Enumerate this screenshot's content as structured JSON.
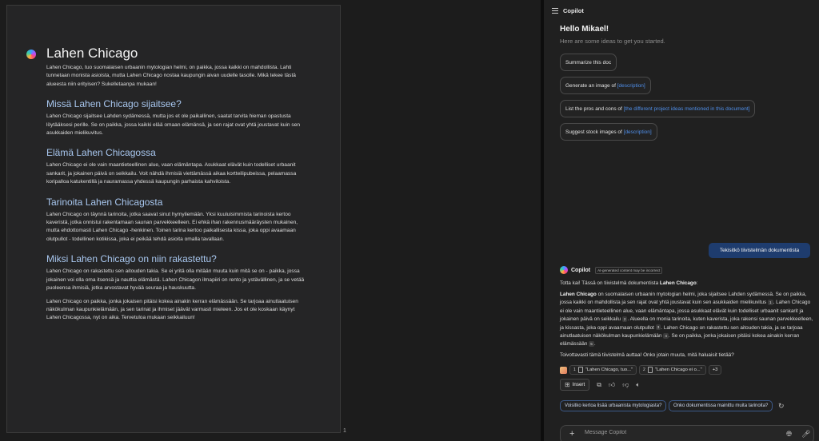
{
  "document": {
    "title": "Lahen Chicago",
    "intro": "Lahen Chicago, tuo suomalaisen urbaanin mytologian helmi, on paikka, jossa kaikki on mahdollista. Lahti tunnetaan monista asioista, mutta Lahen Chicago nostaa kaupungin aivan uudelle tasolle. Mikä tekee tästä alueesta niin erityisen? Sukelletaanpa mukaan!",
    "sections": [
      {
        "heading": "Missä Lahen Chicago sijaitsee?",
        "paragraphs": [
          "Lahen Chicago sijaitsee Lahden sydämessä, mutta jos et ole paikallinen, saatat tarvita hieman opastusta löytääksesi perille. Se on paikka, jossa kaikki elää omaan elämänsä, ja sen rajat ovat yhtä joustavat kuin sen asukkaiden mielikuvitus."
        ]
      },
      {
        "heading": "Elämä Lahen Chicagossa",
        "paragraphs": [
          "Lahen Chicago ei ole vain maantieteellinen alue, vaan elämäntapa. Asukkaat elävät kuin todelliset urbaanit sankarit, ja jokainen päivä on seikkailu. Voit nähdä ihmisiä viettämässä aikaa kortteilipubeissa, pelaamassa koripalloa katukentillä ja nauramassa yhdessä kaupungin parhaista kahviloista."
        ]
      },
      {
        "heading": "Tarinoita Lahen Chicagosta",
        "paragraphs": [
          "Lahen Chicago on täynnä tarinoita, jotka saavat sinut hymyilemään. Yksi kuuluisimmista tarinoista kertoo kaveristä, jotka onnistui rakentamaan saunan parvekkeelleen. Ei ehkä ihan rakennusmääräysten mukainen, mutta ehdottomasti Lahen Chicago -henkinen. Toinen tarina kertoo paikallisesta kissa, joka oppi avaamaan olutpullot - todellinen kotikissa, joka ei peikää tehdä asioita omalla tavallaan."
        ]
      },
      {
        "heading": "Miksi Lahen Chicago on niin rakastettu?",
        "paragraphs": [
          "Lahen Chicago on rakastettu sen aitouden takia. Se ei yritä olla mitään muuta kuin mitä se on - paikka, jossa jokainen voi olla oma itsensä ja nauttia elämästä. Lahen Chicagon ilmapiiri on rento ja ystävällinen, ja se vetää puoleensa ihmisiä, jotka arvostavat hyvää seuraa ja hauskuutta.",
          "Lahen Chicago on paikka, jonka jokaisen pitäisi kokea ainakin kerran elämässään. Se tarjoaa ainutlaatuisen näkökulman kaupunkielämään, ja sen tarinat ja ihmiset jäävät varmasti mieleen. Jos et ole koskaan käynyt Lahen Chicagossa, nyt on aika. Tervetuloa mukaan seikkailuun!"
        ]
      }
    ],
    "page_number": "1"
  },
  "copilot": {
    "title": "Copilot",
    "greeting": "Hello Mikael!",
    "subtitle": "Here are some ideas to get you started.",
    "chips": [
      {
        "text": "Summarize this doc",
        "placeholder": ""
      },
      {
        "text": "Generate an image of ",
        "placeholder": "[description]"
      },
      {
        "text": "List the pros and cons of ",
        "placeholder": "[the different project ideas mentioned in this document]"
      },
      {
        "text": "Suggest stock images of ",
        "placeholder": "[description]"
      }
    ],
    "user_message": "Tekisitkö tiivistelmän dokumentista",
    "response": {
      "name": "Copilot",
      "ai_badge": "AI-generated content may be incorrect",
      "intro_prefix": "Totta kai! Tässä on tiivistelmä dokumentista ",
      "intro_bold": "Lahen Chicago",
      "intro_suffix": ":",
      "summary_bold": "Lahen Chicago",
      "summary_part1": " on suomalaisen urbaanin mytologian helmi, joka sijaitsee Lahden sydämessä. Se on paikka, jossa kaikki on mahdollista ja sen rajat ovat yhtä joustavat kuin sen asukkaiden mielikuvitus",
      "cite1": "1",
      "summary_part2": ". Lahen Chicago ei ole vain maantieteellinen alue, vaan elämäntapa, jossa asukkaat elävät kuin todelliset urbaanit sankarit ja jokainen päivä on seikkailu",
      "cite2": "2",
      "summary_part3": ". Alueella on monia tarinoita, kuten kaverista, joka rakensi saunan parvekkeelleen, ja kissasta, joka oppi avaamaan olutpullot",
      "cite3": "3",
      "summary_part4": ". Lahen Chicago on rakastettu sen aitouden takia, ja se tarjoaa ainutlaatuisen näkökulman kaupunkielämään",
      "cite4": "4",
      "summary_part5": ". Se on paikka, jonka jokaisen pitäisi kokea ainakin kerran elämässään",
      "cite5": "5",
      "summary_end": ".",
      "closing": "Toivottavasti tämä tiivistelmä auttaa! Onko jotain muuta, mitä haluaisit tietää?"
    },
    "references": [
      {
        "num": "1",
        "text": "\"Lahen Chicago, tuo...\""
      },
      {
        "num": "2",
        "text": "\"Lahen Chicago ei o...\""
      }
    ],
    "more_refs": "+3",
    "insert_label": "Insert",
    "suggestions": [
      "Voisitko kertoa lisää urbaanista mytologiasta?",
      "Onko dokumentissa mainittu muita tarinoita?"
    ],
    "composer_placeholder": "Message Copilot"
  }
}
